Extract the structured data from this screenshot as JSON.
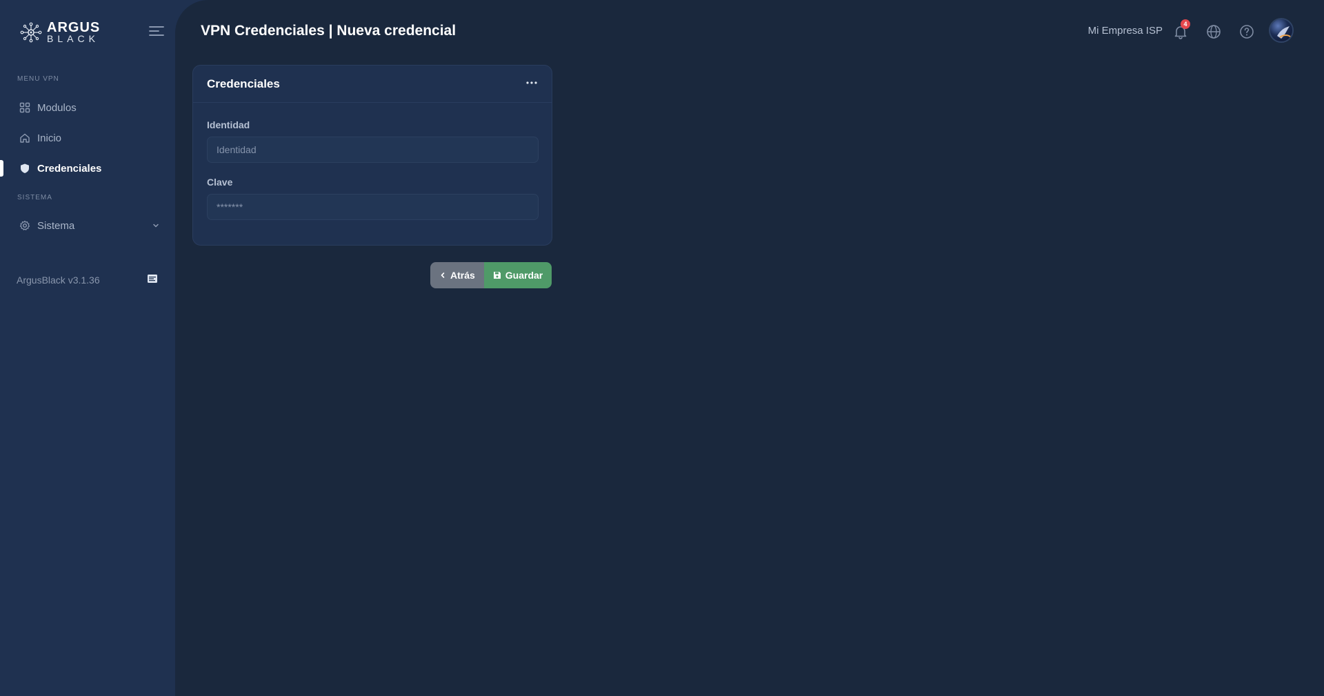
{
  "brand": {
    "name_top": "ARGUS",
    "name_bottom": "BLACK"
  },
  "sidebar": {
    "section_vpn": "MENU VPN",
    "section_system": "SISTEMA",
    "items": [
      {
        "label": "Modulos",
        "icon": "grid-icon"
      },
      {
        "label": "Inicio",
        "icon": "home-icon"
      },
      {
        "label": "Credenciales",
        "icon": "shield-icon",
        "active": true
      },
      {
        "label": "Sistema",
        "icon": "gear-icon"
      }
    ],
    "version": "ArgusBlack v3.1.36"
  },
  "header": {
    "title": "VPN Credenciales | Nueva credencial",
    "company": "Mi Empresa ISP",
    "notification_count": "4"
  },
  "card": {
    "title": "Credenciales",
    "fields": [
      {
        "label": "Identidad",
        "placeholder": "Identidad",
        "value": ""
      },
      {
        "label": "Clave",
        "placeholder": "*******",
        "value": ""
      }
    ]
  },
  "actions": {
    "back_label": "Atrás",
    "save_label": "Guardar"
  },
  "colors": {
    "sidebar_bg": "#1f3150",
    "main_bg": "#1a283d",
    "save": "#4f9a68",
    "back": "#6b7380",
    "badge": "#e5484d"
  }
}
